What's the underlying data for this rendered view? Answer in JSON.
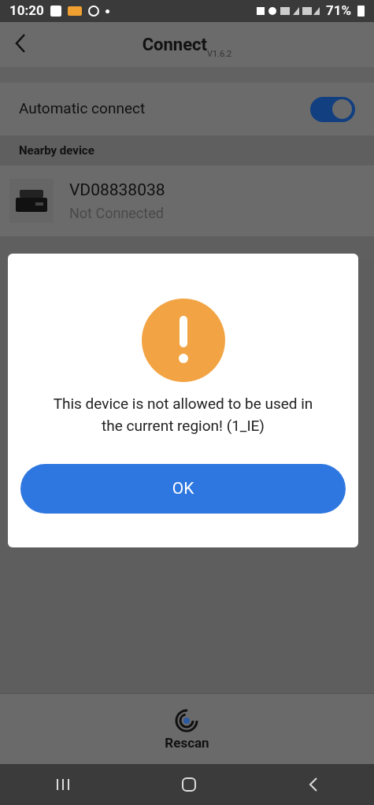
{
  "status_bar": {
    "time": "10:20",
    "battery": "71%"
  },
  "header": {
    "title": "Connect",
    "version": "V1.6.2"
  },
  "auto_connect": {
    "label": "Automatic connect",
    "on": true
  },
  "nearby": {
    "title": "Nearby device",
    "devices": [
      {
        "name": "VD08838038",
        "status": "Not Connected"
      }
    ]
  },
  "dialog": {
    "message": "This device is not allowed to be used in the current region! (1_IE)",
    "button": "OK"
  },
  "bottom": {
    "label": "Rescan"
  }
}
